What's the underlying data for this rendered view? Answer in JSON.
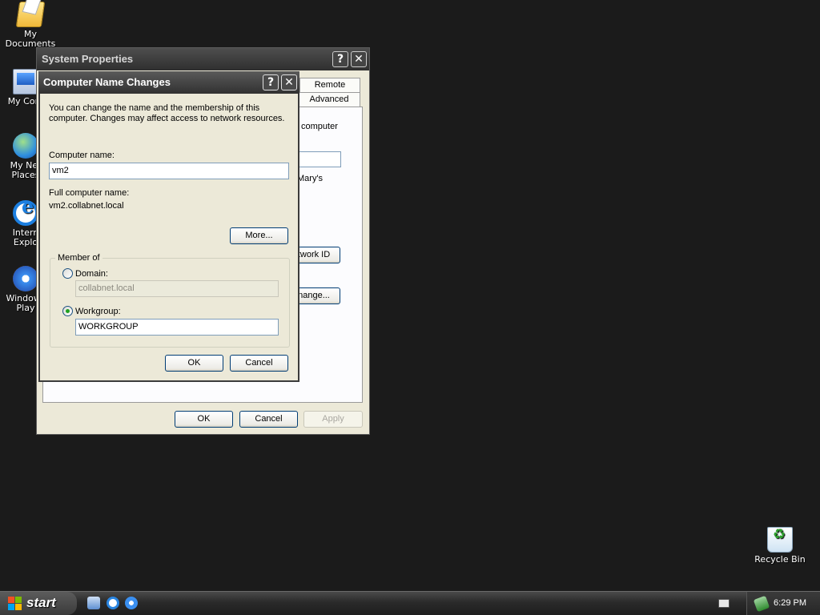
{
  "desktop": {
    "icons": [
      {
        "label": "My Documents"
      },
      {
        "label": "My Com"
      },
      {
        "label": "My Net"
      },
      {
        "label": "Places"
      },
      {
        "label": "Intern"
      },
      {
        "label": "Explo"
      },
      {
        "label": "Windows"
      },
      {
        "label": "Play"
      },
      {
        "label": "Recycle Bin"
      }
    ]
  },
  "system_properties": {
    "title": "System Properties",
    "help_btn": "?",
    "close_btn": "✕",
    "tabs": [
      "Remote",
      "Advanced"
    ],
    "partial_text": [
      "computer",
      "Mary's"
    ],
    "partial_buttons": {
      "network_id": "twork ID",
      "change": "nange..."
    },
    "buttons": {
      "ok": "OK",
      "cancel": "Cancel",
      "apply": "Apply"
    }
  },
  "dialog": {
    "title": "Computer Name Changes",
    "help_btn": "?",
    "close_btn": "✕",
    "intro_line1": "You can change the name and the membership of this",
    "intro_line2": "computer. Changes may affect access to network resources.",
    "computer_name_label": "Computer name:",
    "computer_name_value": "vm2",
    "full_name_label": "Full computer name:",
    "full_name_value": "vm2.collabnet.local",
    "more_button": "More...",
    "member_of_label": "Member of",
    "domain_label": "Domain:",
    "domain_value": "collabnet.local",
    "workgroup_label": "Workgroup:",
    "workgroup_value": "WORKGROUP",
    "selected_membership": "workgroup",
    "ok_button": "OK",
    "cancel_button": "Cancel"
  },
  "taskbar": {
    "start_label": "start",
    "clock": "6:29 PM",
    "quick_launch": [
      "computer-icon",
      "internet-explorer-icon",
      "media-player-icon"
    ]
  }
}
